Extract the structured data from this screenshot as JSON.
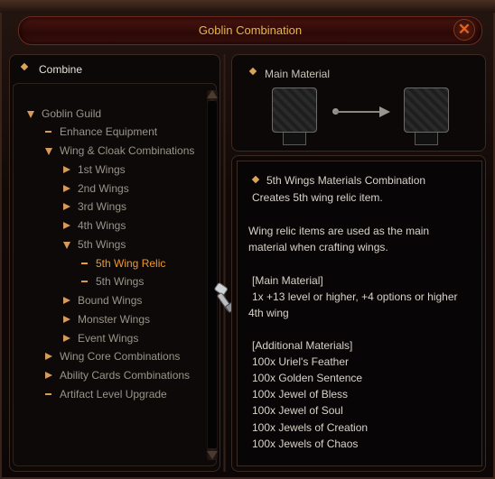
{
  "window": {
    "title": "Goblin Combination",
    "close_glyph": "✕"
  },
  "left_panel": {
    "header": "Combine",
    "tree": [
      {
        "label": "Goblin Guild",
        "marker": "arrow-down",
        "level": 0
      },
      {
        "label": "Enhance Equipment",
        "marker": "dash",
        "level": 1
      },
      {
        "label": "Wing & Cloak Combinations",
        "marker": "arrow-down",
        "level": 1
      },
      {
        "label": "1st Wings",
        "marker": "arrow-right",
        "level": 2
      },
      {
        "label": "2nd Wings",
        "marker": "arrow-right",
        "level": 2
      },
      {
        "label": "3rd Wings",
        "marker": "arrow-right",
        "level": 2
      },
      {
        "label": "4th Wings",
        "marker": "arrow-right",
        "level": 2
      },
      {
        "label": "5th Wings",
        "marker": "arrow-down",
        "level": 2
      },
      {
        "label": "5th Wing Relic",
        "marker": "dash",
        "level": 3,
        "selected": true
      },
      {
        "label": "5th Wings",
        "marker": "dash",
        "level": 3
      },
      {
        "label": "Bound Wings",
        "marker": "arrow-right",
        "level": 2
      },
      {
        "label": "Monster Wings",
        "marker": "arrow-right",
        "level": 2
      },
      {
        "label": "Event Wings",
        "marker": "arrow-right",
        "level": 2
      },
      {
        "label": "Wing Core Combinations",
        "marker": "arrow-right",
        "level": 1
      },
      {
        "label": "Ability Cards Combinations",
        "marker": "arrow-right",
        "level": 1
      },
      {
        "label": "Artifact Level Upgrade",
        "marker": "dash",
        "level": 1
      }
    ]
  },
  "material_panel": {
    "header": "Main Material"
  },
  "detail": {
    "title": "5th Wings Materials Combination",
    "summary": "Creates 5th wing relic item.",
    "desc_line1": "Wing relic items are used as the main",
    "desc_line2": "material when crafting wings.",
    "main_material_header": "[Main Material]",
    "main_material_line1": "1x +13 level or higher, +4 options or higher",
    "main_material_line2": "4th wing",
    "additional_header": "[Additional Materials]",
    "additional": [
      "100x Uriel's Feather",
      "100x Golden Sentence",
      "100x Jewel of Bless",
      "100x Jewel of Soul",
      "100x Jewels of Creation",
      "100x Jewels of Chaos"
    ]
  },
  "icons": {
    "close": "close-icon",
    "hammer": "hammer-icon",
    "arrow": "combine-arrow-icon"
  }
}
